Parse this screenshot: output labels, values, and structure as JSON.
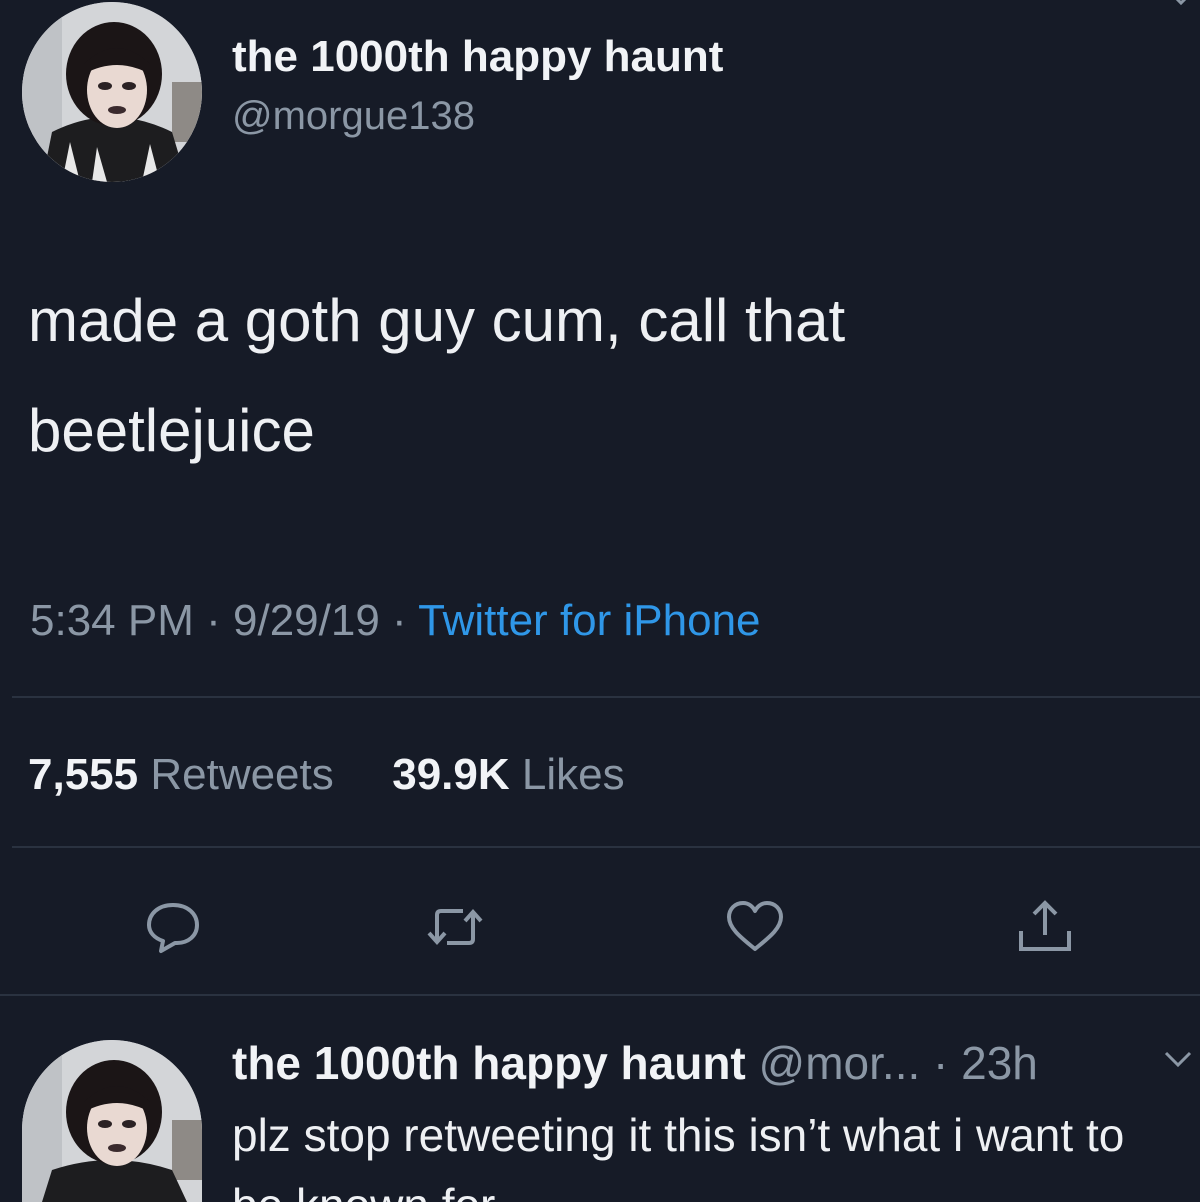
{
  "tweet": {
    "author_name": "the 1000th happy haunt",
    "author_handle": "@morgue138",
    "text_line1": "made a goth guy cum, call that",
    "text_line2": "beetlejuice",
    "time": "5:34 PM",
    "date": "9/29/19",
    "separator": "·",
    "source": "Twitter for iPhone",
    "retweets_count": "7,555",
    "retweets_label": "Retweets",
    "likes_count": "39.9K",
    "likes_label": "Likes"
  },
  "actions": [
    {
      "icon": "reply-icon"
    },
    {
      "icon": "retweet-icon"
    },
    {
      "icon": "like-heart-icon"
    },
    {
      "icon": "share-icon"
    }
  ],
  "reply": {
    "author_name": "the 1000th happy haunt",
    "author_handle": "@mor...",
    "separator": "·",
    "age": "23h",
    "text": "plz stop retweeting it this isn’t what i want to be known for"
  },
  "colors": {
    "background": "#161b27",
    "divider": "#2a3240",
    "secondary_text": "#8b97a5",
    "link": "#2f97e8"
  }
}
